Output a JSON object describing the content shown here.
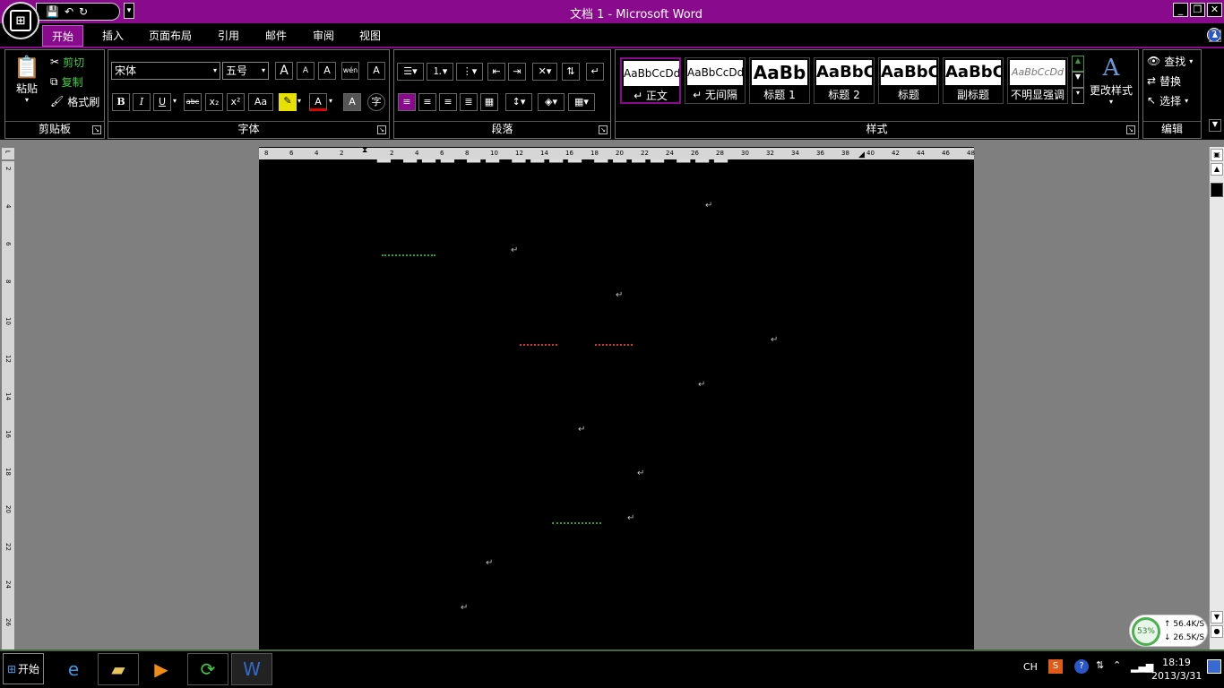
{
  "window": {
    "title": "文档 1 - Microsoft Word",
    "minimize": "_",
    "restore": "❐",
    "close": "✕"
  },
  "qat": {
    "save": "💾",
    "undo": "↶",
    "redo": "↻",
    "more": "▾"
  },
  "tabs": [
    "开始",
    "插入",
    "页面布局",
    "引用",
    "邮件",
    "审阅",
    "视图"
  ],
  "active_tab": "开始",
  "clipboard": {
    "paste_label": "粘贴",
    "cut_label": "剪切",
    "copy_label": "复制",
    "format_painter_label": "格式刷",
    "group_label": "剪贴板"
  },
  "font": {
    "font_name": "宋体",
    "font_size": "五号",
    "group_label": "字体",
    "bold": "B",
    "italic": "I",
    "underline": "U",
    "strike": "abc",
    "subscript": "x₂",
    "superscript": "x²",
    "change_case": "Aa",
    "grow": "A",
    "shrink": "A",
    "clear": "A",
    "phonetic": "wén",
    "border_char": "A",
    "font_color": "A",
    "char_shade": "A",
    "enclose": "字"
  },
  "paragraph": {
    "group_label": "段落"
  },
  "styles": {
    "group_label": "样式",
    "items": [
      {
        "sample": "AaBbCcDd",
        "name": "↵ 正文"
      },
      {
        "sample": "AaBbCcDd",
        "name": "↵ 无间隔"
      },
      {
        "sample": "AaBb",
        "name": "标题 1"
      },
      {
        "sample": "AaBbC",
        "name": "标题 2"
      },
      {
        "sample": "AaBbC",
        "name": "标题"
      },
      {
        "sample": "AaBbC",
        "name": "副标题"
      },
      {
        "sample": "AaBbCcDd",
        "name": "不明显强调"
      }
    ],
    "change_styles_label": "更改样式"
  },
  "editing": {
    "find_label": "查找",
    "replace_label": "替换",
    "select_label": "选择",
    "group_label": "编辑"
  },
  "hruler_ticks": [
    "8",
    "6",
    "4",
    "2",
    "",
    "2",
    "4",
    "6",
    "8",
    "10",
    "12",
    "14",
    "16",
    "18",
    "20",
    "22",
    "24",
    "26",
    "28",
    "30",
    "32",
    "34",
    "36",
    "38",
    "40",
    "42",
    "44",
    "46",
    "48"
  ],
  "vruler_ticks": [
    "2",
    "4",
    "6",
    "8",
    "10",
    "12",
    "14",
    "16",
    "18",
    "20",
    "22",
    "24",
    "26"
  ],
  "document": {
    "paragraph_mark": "↵"
  },
  "taskbar": {
    "start_label": "开始",
    "lang": "CH",
    "time": "18:19",
    "date": "2013/3/31"
  },
  "network": {
    "percent": "53%",
    "up": "↑ 56.4K/S",
    "down": "↓ 26.5K/S"
  },
  "colors": {
    "accent": "#8a0a8e",
    "ruler": "#d6d6d6",
    "workspace": "#7f7f7f",
    "spell_red": "#d0372f",
    "grammar_green": "#2f9e3a"
  }
}
